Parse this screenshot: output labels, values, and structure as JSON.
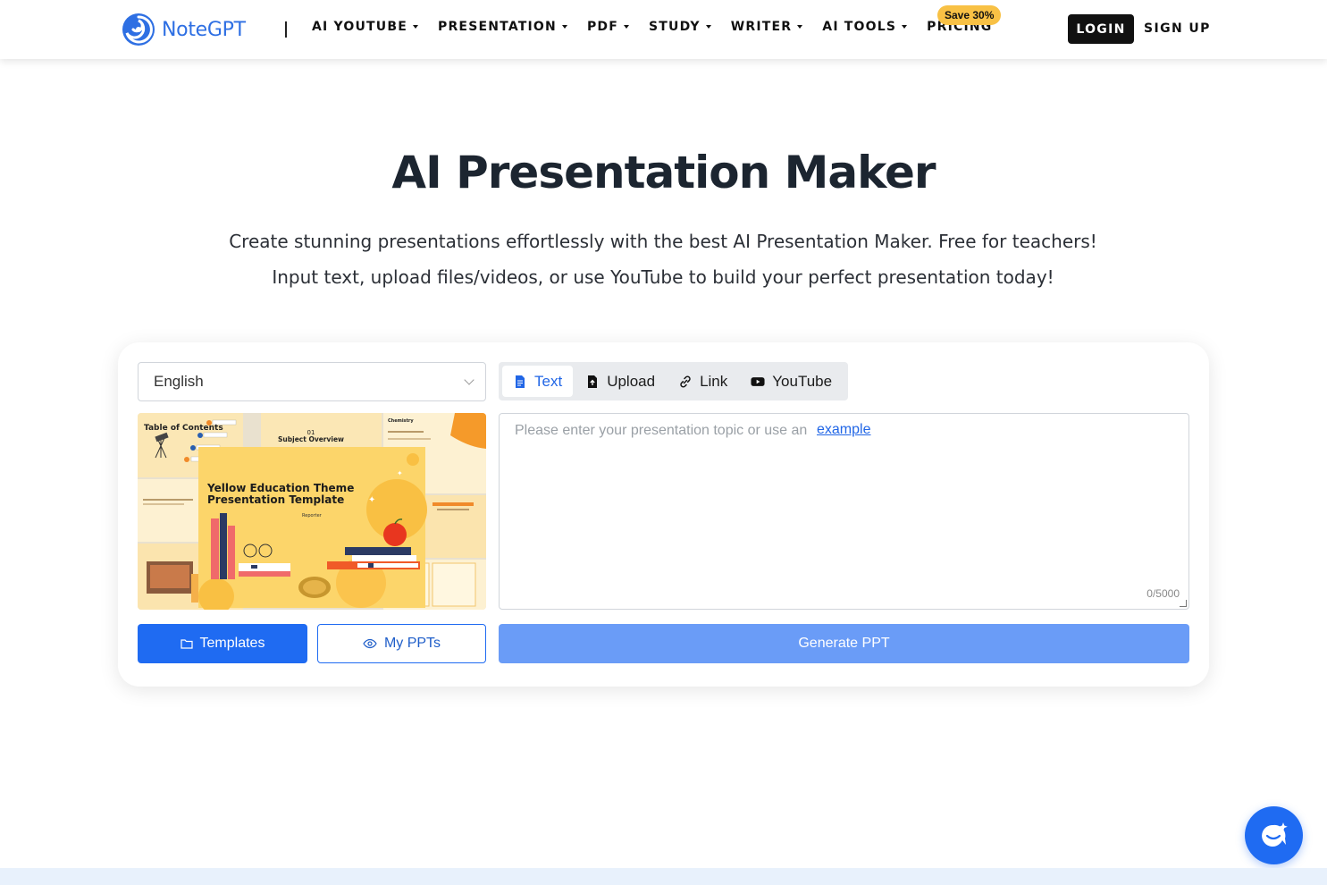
{
  "header": {
    "logo_text": "NoteGPT",
    "nav": [
      {
        "label": "AI YOUTUBE",
        "has_caret": true
      },
      {
        "label": "PRESENTATION",
        "has_caret": true
      },
      {
        "label": "PDF",
        "has_caret": true
      },
      {
        "label": "STUDY",
        "has_caret": true
      },
      {
        "label": "WRITER",
        "has_caret": true
      },
      {
        "label": "AI TOOLS",
        "has_caret": true
      },
      {
        "label": "PRICING",
        "has_caret": false
      }
    ],
    "save_badge": "Save 30%",
    "login_label": "LOGIN",
    "signup_label": "SIGN UP"
  },
  "hero": {
    "title": "AI Presentation Maker",
    "subtitle": "Create stunning presentations effortlessly with the best AI Presentation Maker. Free for teachers! Input text, upload files/videos, or use YouTube to build your perfect presentation today!"
  },
  "generator": {
    "language": "English",
    "tabs": [
      {
        "label": "Text",
        "icon": "document-icon",
        "active": true
      },
      {
        "label": "Upload",
        "icon": "upload-icon",
        "active": false
      },
      {
        "label": "Link",
        "icon": "link-icon",
        "active": false
      },
      {
        "label": "YouTube",
        "icon": "youtube-icon",
        "active": false
      }
    ],
    "input_placeholder": "Please enter your presentation topic or use an",
    "example_link": "example",
    "char_counter": "0/5000",
    "template_preview": {
      "title": "Yellow Education Theme Presentation Template",
      "reporter": "Reporter",
      "toc_label": "Table of Contents",
      "section_number": "01",
      "section_title": "Subject Overview",
      "side_label": "Chemistry"
    },
    "templates_button": "Templates",
    "my_ppts_button": "My PPTs",
    "generate_button": "Generate PPT"
  },
  "colors": {
    "brand_blue": "#1f6bf2",
    "generate_disabled": "#6a9cf7",
    "badge_yellow": "#f8c145",
    "template_yellow": "#fcd56a"
  }
}
